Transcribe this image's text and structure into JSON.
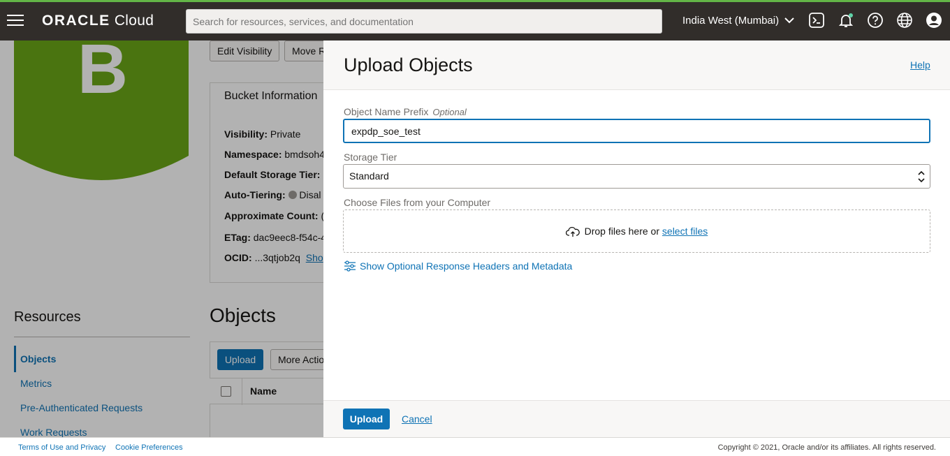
{
  "header": {
    "logo_brand": "ORACLE",
    "logo_product": "Cloud",
    "search_placeholder": "Search for resources, services, and documentation",
    "region": "India West (Mumbai)",
    "accent_color": "#63b547"
  },
  "bucket": {
    "icon_letter": "B",
    "icon_color": "#6aa617",
    "actions": [
      "Edit Visibility",
      "Move R"
    ],
    "info_title": "Bucket Information",
    "rows": [
      {
        "label": "Visibility:",
        "value": "Private"
      },
      {
        "label": "Namespace:",
        "value": "bmdsoh4"
      },
      {
        "label": "Default Storage Tier:",
        "value": ""
      },
      {
        "label": "Auto-Tiering:",
        "value": "Disal"
      },
      {
        "label": "Approximate Count:",
        "value": "("
      },
      {
        "label": "ETag:",
        "value": "dac9eec8-f54c-4"
      },
      {
        "label": "OCID:",
        "value": "...3qtjob2q",
        "link": "Sho"
      }
    ]
  },
  "resources": {
    "title": "Resources",
    "items": [
      "Objects",
      "Metrics",
      "Pre-Authenticated Requests",
      "Work Requests"
    ]
  },
  "objects": {
    "title": "Objects",
    "upload_label": "Upload",
    "more_actions_label": "More Actio",
    "col_name": "Name"
  },
  "drawer": {
    "title": "Upload Objects",
    "help": "Help",
    "prefix_label": "Object Name Prefix",
    "prefix_optional": "Optional",
    "prefix_value": "expdp_soe_test",
    "tier_label": "Storage Tier",
    "tier_value": "Standard",
    "files_label": "Choose Files from your Computer",
    "drop_text": "Drop files here or",
    "select_files": "select files",
    "optional_headers": "Show Optional Response Headers and Metadata",
    "upload_button": "Upload",
    "cancel_button": "Cancel"
  },
  "footer": {
    "terms": "Terms of Use and Privacy",
    "cookies": "Cookie Preferences",
    "copyright": "Copyright © 2021, Oracle and/or its affiliates. All rights reserved."
  }
}
